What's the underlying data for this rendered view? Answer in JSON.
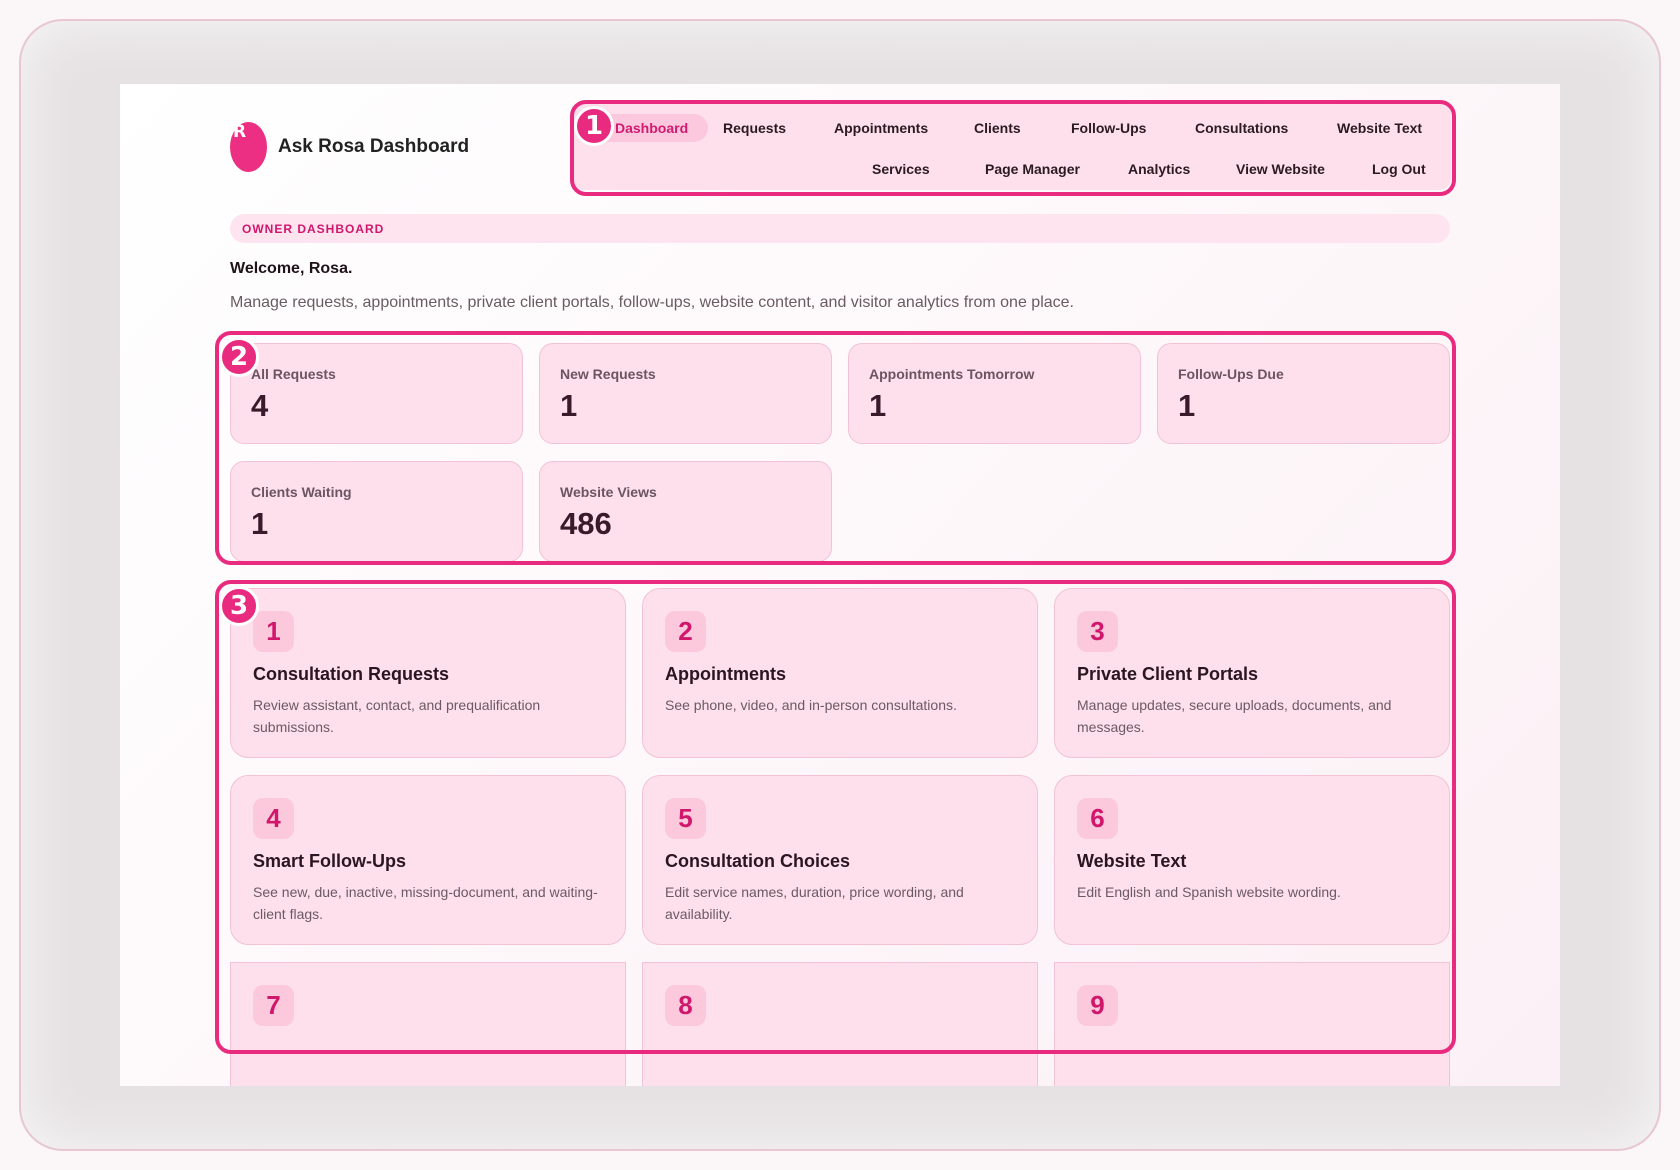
{
  "brand": {
    "logo_letter": "R",
    "name": "Ask Rosa Dashboard"
  },
  "nav": {
    "items": [
      {
        "label": "Dashboard",
        "active": true
      },
      {
        "label": "Requests"
      },
      {
        "label": "Appointments"
      },
      {
        "label": "Clients"
      },
      {
        "label": "Follow-Ups"
      },
      {
        "label": "Consultations"
      },
      {
        "label": "Website Text"
      },
      {
        "label": "Services"
      },
      {
        "label": "Page Manager"
      },
      {
        "label": "Analytics"
      },
      {
        "label": "View Website"
      },
      {
        "label": "Log Out"
      }
    ]
  },
  "header": {
    "owner_label": "OWNER DASHBOARD",
    "welcome": "Welcome, Rosa.",
    "subtitle": "Manage requests, appointments, private client portals, follow-ups, website content, and visitor analytics from one place."
  },
  "stats": [
    {
      "label": "All Requests",
      "value": "4"
    },
    {
      "label": "New Requests",
      "value": "1"
    },
    {
      "label": "Appointments Tomorrow",
      "value": "1"
    },
    {
      "label": "Follow-Ups Due",
      "value": "1"
    },
    {
      "label": "Clients Waiting",
      "value": "1"
    },
    {
      "label": "Website Views",
      "value": "486"
    }
  ],
  "tools": [
    {
      "num": "1",
      "title": "Consultation Requests",
      "desc": "Review assistant, contact, and prequalification submissions."
    },
    {
      "num": "2",
      "title": "Appointments",
      "desc": "See phone, video, and in-person consultations."
    },
    {
      "num": "3",
      "title": "Private Client Portals",
      "desc": "Manage updates, secure uploads, documents, and messages."
    },
    {
      "num": "4",
      "title": "Smart Follow-Ups",
      "desc": "See new, due, inactive, missing-document, and waiting-client flags."
    },
    {
      "num": "5",
      "title": "Consultation Choices",
      "desc": "Edit service names, duration, price wording, and availability."
    },
    {
      "num": "6",
      "title": "Website Text",
      "desc": "Edit English and Spanish website wording."
    },
    {
      "num": "7"
    },
    {
      "num": "8"
    },
    {
      "num": "9"
    }
  ],
  "markers": [
    "1",
    "2",
    "3"
  ],
  "colors": {
    "accent": "#e92b80",
    "card_bg": "#fde0ec",
    "badge_text": "#d0176c"
  }
}
